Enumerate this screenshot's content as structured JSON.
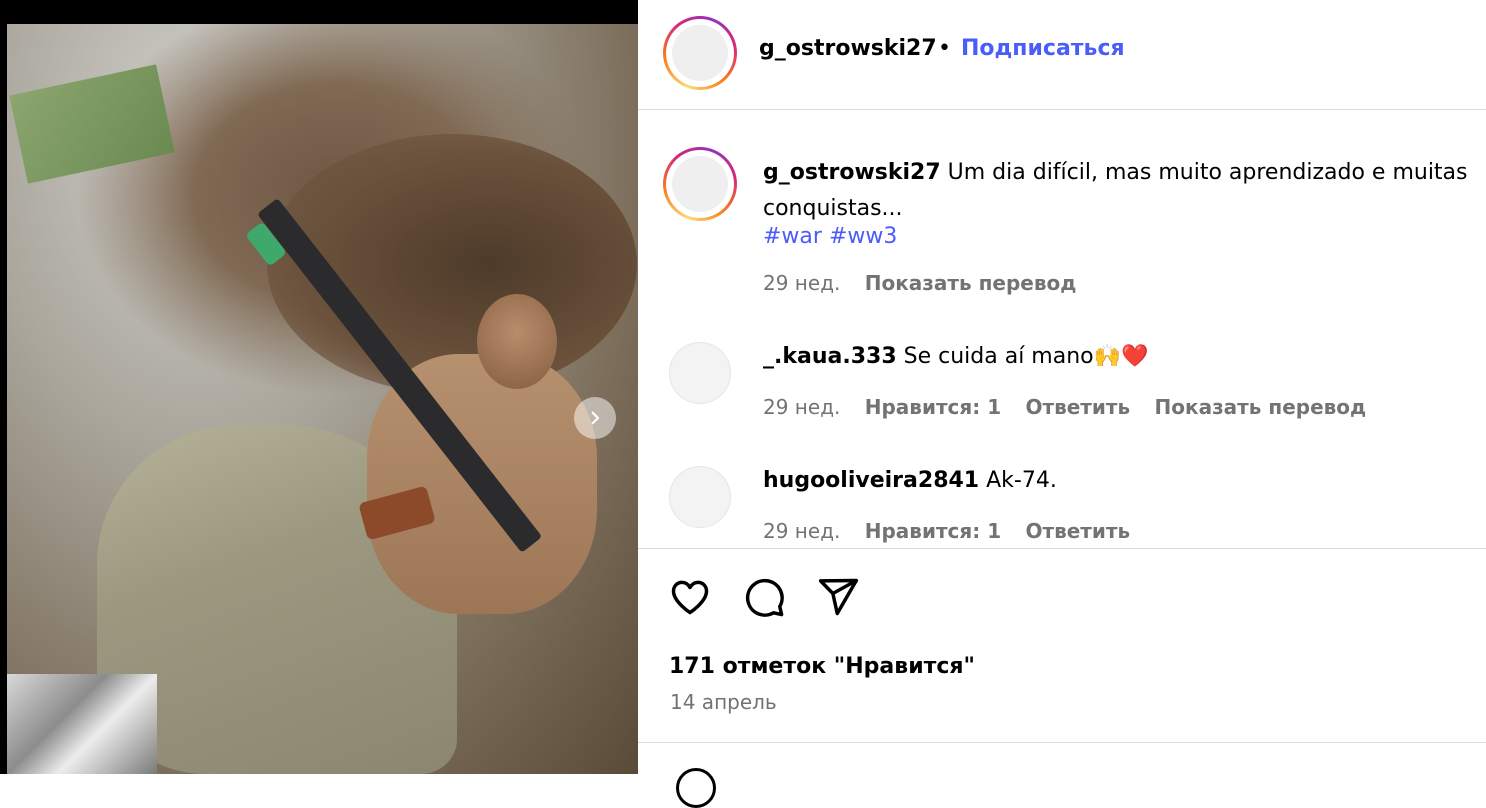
{
  "post": {
    "author": "g_ostrowski27",
    "follow_label": "Подписаться",
    "separator": "•",
    "caption": "Um dia difícil, mas muito aprendizado e muitas conquistas...",
    "hashtags": "#war #ww3",
    "age": "29 нед.",
    "translate_label": "Показать перевод"
  },
  "comments": [
    {
      "user": "_.kaua.333",
      "text": "Se cuida aí mano🙌❤️",
      "age": "29 нед.",
      "likes_label": "Нравится: 1",
      "reply_label": "Ответить",
      "translate_label": "Показать перевод"
    },
    {
      "user": "hugooliveira2841",
      "text": "Ak-74.",
      "age": "29 нед.",
      "likes_label": "Нравится: 1",
      "reply_label": "Ответить"
    }
  ],
  "actions": {
    "like_icon": "heart-icon",
    "comment_icon": "comment-icon",
    "share_icon": "share-icon"
  },
  "stats": {
    "likes": "171 отметок \"Нравится\"",
    "date": "14 апрель"
  },
  "colors": {
    "link": "#4a5df9",
    "muted": "#737373",
    "divider": "#dbdbdb"
  }
}
